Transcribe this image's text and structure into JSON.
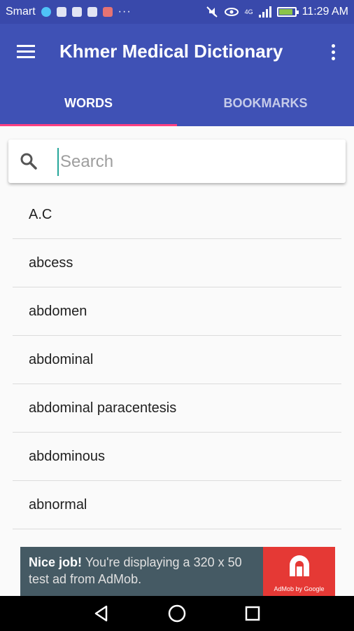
{
  "status_bar": {
    "carrier": "Smart",
    "dots": "···",
    "time": "11:29 AM",
    "network": "4G",
    "battery_level": 0.85
  },
  "app_bar": {
    "title": "Khmer Medical Dictionary"
  },
  "tabs": [
    {
      "label": "WORDS",
      "active": true
    },
    {
      "label": "BOOKMARKS",
      "active": false
    }
  ],
  "search": {
    "placeholder": "Search",
    "value": ""
  },
  "words": [
    "A.C",
    "abcess",
    "abdomen",
    "abdominal",
    "abdominal paracentesis",
    "abdominous",
    "abnormal"
  ],
  "ad": {
    "headline": "Nice job!",
    "body": " You're displaying a 320 x 50 test ad from AdMob.",
    "caption": "AdMob by Google"
  },
  "colors": {
    "primary": "#3f51b5",
    "primary_dark": "#3949ab",
    "accent": "#ff4081",
    "ad_background": "#455a64",
    "ad_logo": "#e53935"
  }
}
